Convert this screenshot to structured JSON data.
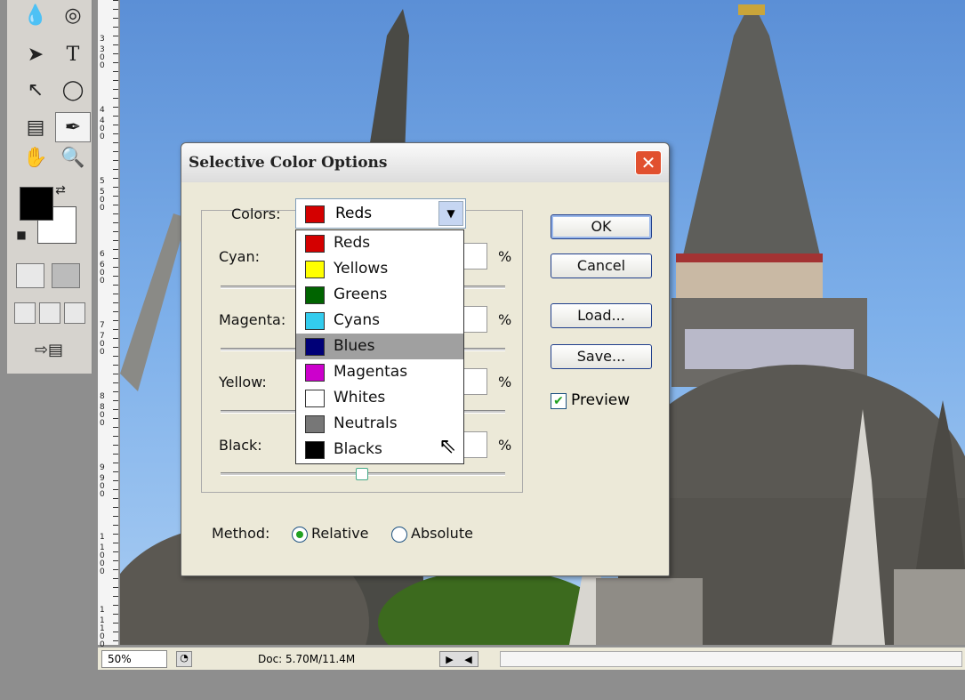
{
  "status_bar": {
    "zoom": "50%",
    "doc": "Doc: 5.70M/11.4M"
  },
  "ruler": {
    "labels": [
      "3",
      "300",
      "4",
      "400",
      "5",
      "500",
      "6",
      "600",
      "7",
      "700",
      "8",
      "800",
      "9",
      "900",
      "1",
      "1000",
      "1",
      "1100"
    ]
  },
  "dialog": {
    "title": "Selective Color Options",
    "close_glyph": "✕",
    "colors_label": "Colors:",
    "selected_color": "Reds",
    "selected_hex": "#d40000",
    "options": [
      {
        "label": "Reds",
        "hex": "#d40000"
      },
      {
        "label": "Yellows",
        "hex": "#ffff00"
      },
      {
        "label": "Greens",
        "hex": "#006400"
      },
      {
        "label": "Cyans",
        "hex": "#33ccee"
      },
      {
        "label": "Blues",
        "hex": "#000077"
      },
      {
        "label": "Magentas",
        "hex": "#cc00cc"
      },
      {
        "label": "Whites",
        "hex": "#ffffff"
      },
      {
        "label": "Neutrals",
        "hex": "#777777"
      },
      {
        "label": "Blacks",
        "hex": "#000000"
      }
    ],
    "highlighted_option": "Blues",
    "sliders": [
      {
        "label": "Cyan:",
        "unit": "%"
      },
      {
        "label": "Magenta:",
        "unit": "%"
      },
      {
        "label": "Yellow:",
        "unit": "%"
      },
      {
        "label": "Black:",
        "unit": "%"
      }
    ],
    "buttons": {
      "ok": "OK",
      "cancel": "Cancel",
      "load": "Load...",
      "save": "Save..."
    },
    "preview": {
      "label": "Preview",
      "checked": true
    },
    "method": {
      "label": "Method:",
      "relative": "Relative",
      "absolute": "Absolute",
      "selected": "Relative"
    }
  }
}
